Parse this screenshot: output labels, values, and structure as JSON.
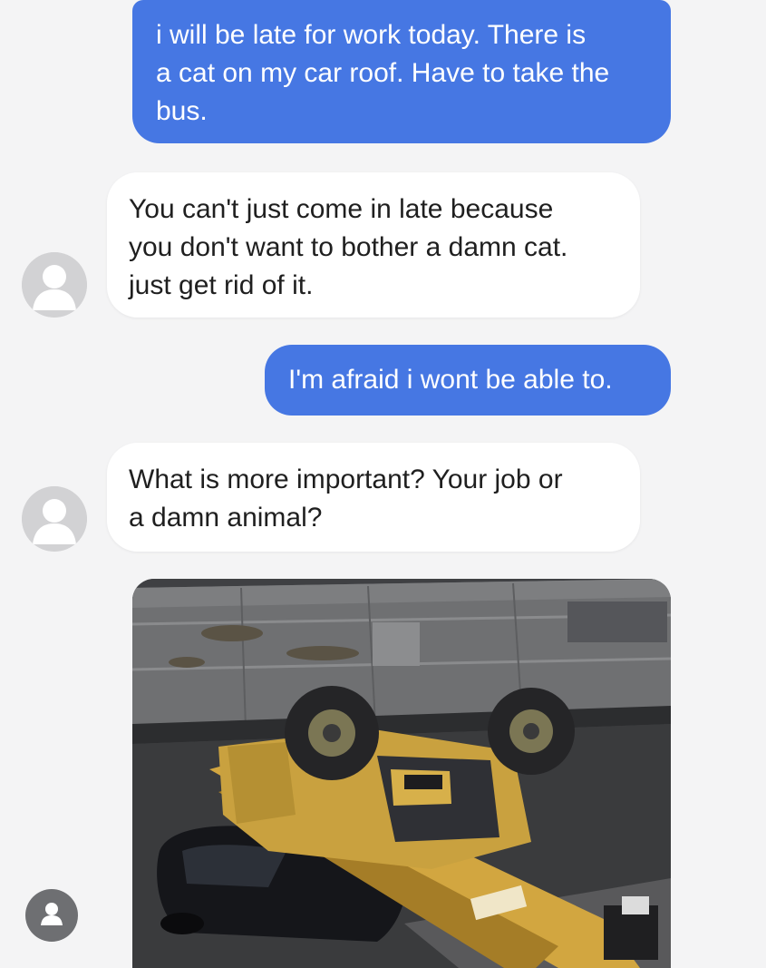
{
  "messages": [
    {
      "id": "msg1",
      "direction": "sent",
      "text": "i will be late for work today. There is\na cat on my car roof. Have to take the\nbus."
    },
    {
      "id": "msg2",
      "direction": "received",
      "text": "You can't just come in late because\nyou don't want to bother a damn cat.\njust get rid of it."
    },
    {
      "id": "msg3",
      "direction": "sent",
      "text": "I'm afraid i wont be able to."
    },
    {
      "id": "msg4",
      "direction": "received",
      "text": "What is more important? Your job or\na damn animal?"
    }
  ],
  "attachment": {
    "kind": "photo",
    "subject": "overturned yellow telehandler crane lying on a crushed black car"
  },
  "icons": {
    "contact_avatar": "person-silhouette-icon",
    "profile_button": "person-icon"
  },
  "colors": {
    "sent_bubble": "#4677e3",
    "received_bubble": "#ffffff",
    "background": "#f4f4f5",
    "avatar": "#d2d2d4"
  }
}
